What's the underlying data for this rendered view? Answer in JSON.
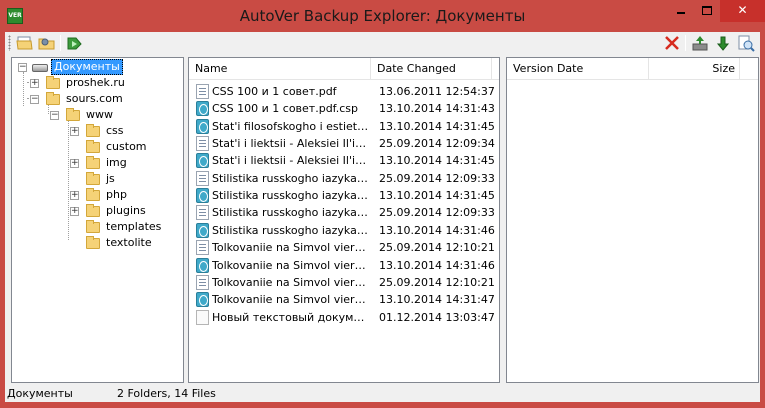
{
  "window": {
    "title": "AutoVer Backup Explorer: Документы",
    "app_icon_text": "VER",
    "close_glyph": "✕"
  },
  "toolbar": {
    "icons": [
      "open-folder-icon",
      "settings-folder-icon",
      "restore-icon",
      "delete-icon",
      "backup-icon",
      "download-icon",
      "compare-icon"
    ]
  },
  "tree": {
    "root": {
      "label": "Документы",
      "expander": "−"
    },
    "items": [
      {
        "label": "proshek.ru",
        "expander": "+"
      },
      {
        "label": "sours.com",
        "expander": "−"
      },
      {
        "label": "www",
        "expander": "−"
      },
      {
        "label": "css",
        "expander": "+"
      },
      {
        "label": "custom",
        "expander": ""
      },
      {
        "label": "img",
        "expander": "+"
      },
      {
        "label": "js",
        "expander": ""
      },
      {
        "label": "php",
        "expander": "+"
      },
      {
        "label": "plugins",
        "expander": "+"
      },
      {
        "label": "templates",
        "expander": ""
      },
      {
        "label": "textolite",
        "expander": ""
      }
    ]
  },
  "files": {
    "columns": {
      "name": "Name",
      "date": "Date Changed"
    },
    "rows": [
      {
        "icon": "doc",
        "name": "CSS 100 и 1 совет.pdf",
        "date": "13.06.2011 12:54:37"
      },
      {
        "icon": "ver",
        "name": "CSS 100 и 1 совет.pdf.csp",
        "date": "13.10.2014 14:31:43"
      },
      {
        "icon": "ver",
        "name": "Stat'i filosofskogho i estietichie...",
        "date": "13.10.2014 14:31:45"
      },
      {
        "icon": "doc",
        "name": "Stat'i i liektsii - Aleksiei Il'ich Os...",
        "date": "25.09.2014 12:09:34"
      },
      {
        "icon": "ver",
        "name": "Stat'i i liektsii - Aleksiei Il'ich Os...",
        "date": "13.10.2014 14:31:45"
      },
      {
        "icon": "doc",
        "name": "Stilistika russkogho iazyka - Irin...",
        "date": "25.09.2014 12:09:33"
      },
      {
        "icon": "ver",
        "name": "Stilistika russkogho iazyka - Irin...",
        "date": "13.10.2014 14:31:45"
      },
      {
        "icon": "doc",
        "name": "Stilistika russkogho iazyka - Irin...",
        "date": "25.09.2014 12:09:33"
      },
      {
        "icon": "ver",
        "name": "Stilistika russkogho iazyka - Irin...",
        "date": "13.10.2014 14:31:46"
      },
      {
        "icon": "doc",
        "name": "Tolkovaniie na Simvol viery - Vl...",
        "date": "25.09.2014 12:10:21"
      },
      {
        "icon": "ver",
        "name": "Tolkovaniie na Simvol viery - Vl...",
        "date": "13.10.2014 14:31:46"
      },
      {
        "icon": "doc",
        "name": "Tolkovaniie na Simvol viery - Vl...",
        "date": "25.09.2014 12:10:21"
      },
      {
        "icon": "ver",
        "name": "Tolkovaniie na Simvol viery - Vl...",
        "date": "13.10.2014 14:31:47"
      },
      {
        "icon": "plain",
        "name": "Новый текстовый документ.txt",
        "date": "01.12.2014 13:03:47"
      }
    ]
  },
  "versions": {
    "columns": {
      "date": "Version Date",
      "size": "Size"
    }
  },
  "status": {
    "path": "Документы",
    "summary": "2 Folders, 14 Files"
  },
  "colors": {
    "titlebar": "#c94b44",
    "close_button": "#c7302b",
    "selection": "#3399ff"
  }
}
